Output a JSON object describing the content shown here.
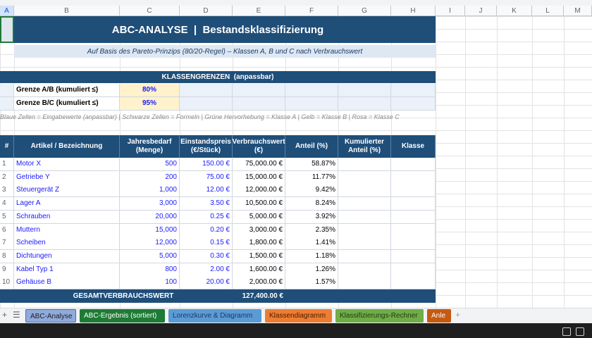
{
  "columns": [
    "A",
    "B",
    "C",
    "D",
    "E",
    "F",
    "G",
    "H",
    "I",
    "J",
    "K",
    "L",
    "M"
  ],
  "title": "ABC-ANALYSE  |  Bestandsklassifizierung",
  "subtitle": "Auf Basis des Pareto-Prinzips (80/20-Regel) – Klassen A, B und C nach Verbrauchswert",
  "limits": {
    "header": "KLASSENGRENZEN  (anpassbar)",
    "rows": [
      {
        "label": "Grenze A/B (kumuliert ≤)",
        "value": "80%"
      },
      {
        "label": "Grenze B/C (kumuliert ≤)",
        "value": "95%"
      }
    ]
  },
  "note": "Blaue Zellen = Eingabewerte (anpassbar)  |  Schwarze Zellen = Formeln  |  Grüne Hervorhebung = Klasse A  |  Gelb = Klasse B  |  Rosa = Klasse C",
  "table": {
    "headers": [
      "#",
      "Artikel / Bezeichnung",
      "Jahresbedarf (Menge)",
      "Einstandspreis (€/Stück)",
      "Verbrauchswert (€)",
      "Anteil (%)",
      "Kumulierter Anteil (%)",
      "Klasse"
    ],
    "rows": [
      [
        "1",
        "Motor X",
        "500",
        "150.00 €",
        "75,000.00 €",
        "58.87%"
      ],
      [
        "2",
        "Getriebe Y",
        "200",
        "75.00 €",
        "15,000.00 €",
        "11.77%"
      ],
      [
        "3",
        "Steuergerät Z",
        "1,000",
        "12.00 €",
        "12,000.00 €",
        "9.42%"
      ],
      [
        "4",
        "Lager A",
        "3,000",
        "3.50 €",
        "10,500.00 €",
        "8.24%"
      ],
      [
        "5",
        "Schrauben",
        "20,000",
        "0.25 €",
        "5,000.00 €",
        "3.92%"
      ],
      [
        "6",
        "Muttern",
        "15,000",
        "0.20 €",
        "3,000.00 €",
        "2.35%"
      ],
      [
        "7",
        "Scheiben",
        "12,000",
        "0.15 €",
        "1,800.00 €",
        "1.41%"
      ],
      [
        "8",
        "Dichtungen",
        "5,000",
        "0.30 €",
        "1,500.00 €",
        "1.18%"
      ],
      [
        "9",
        "Kabel Typ 1",
        "800",
        "2.00 €",
        "1,600.00 €",
        "1.26%"
      ],
      [
        "10",
        "Gehäuse B",
        "100",
        "20.00 €",
        "2,000.00 €",
        "1.57%"
      ]
    ],
    "total_label": "GESAMTVERBRAUCHSWERT",
    "total_value": "127,400.00 €"
  },
  "tabs": [
    {
      "label": "ABC-Analyse",
      "bg": "#8faadc",
      "fg": "#1f1f1f",
      "active": true
    },
    {
      "label": "ABC-Ergebnis (sortiert)",
      "bg": "#1e7b34",
      "fg": "#ffffff"
    },
    {
      "label": "Lorenzkurve & Diagramm",
      "bg": "#5b9bd5",
      "fg": "#1f3864"
    },
    {
      "label": "Klassendiagramm",
      "bg": "#ed7d31",
      "fg": "#4a1d00"
    },
    {
      "label": "Klassifizierungs-Rechner",
      "bg": "#70ad47",
      "fg": "#1f3a10"
    },
    {
      "label": "Anle",
      "bg": "#c55a11",
      "fg": "#ffffff"
    }
  ],
  "colors": {
    "navy": "#1f4e79",
    "input_yellow": "#fff2cc",
    "input_text": "#1a1aff"
  }
}
